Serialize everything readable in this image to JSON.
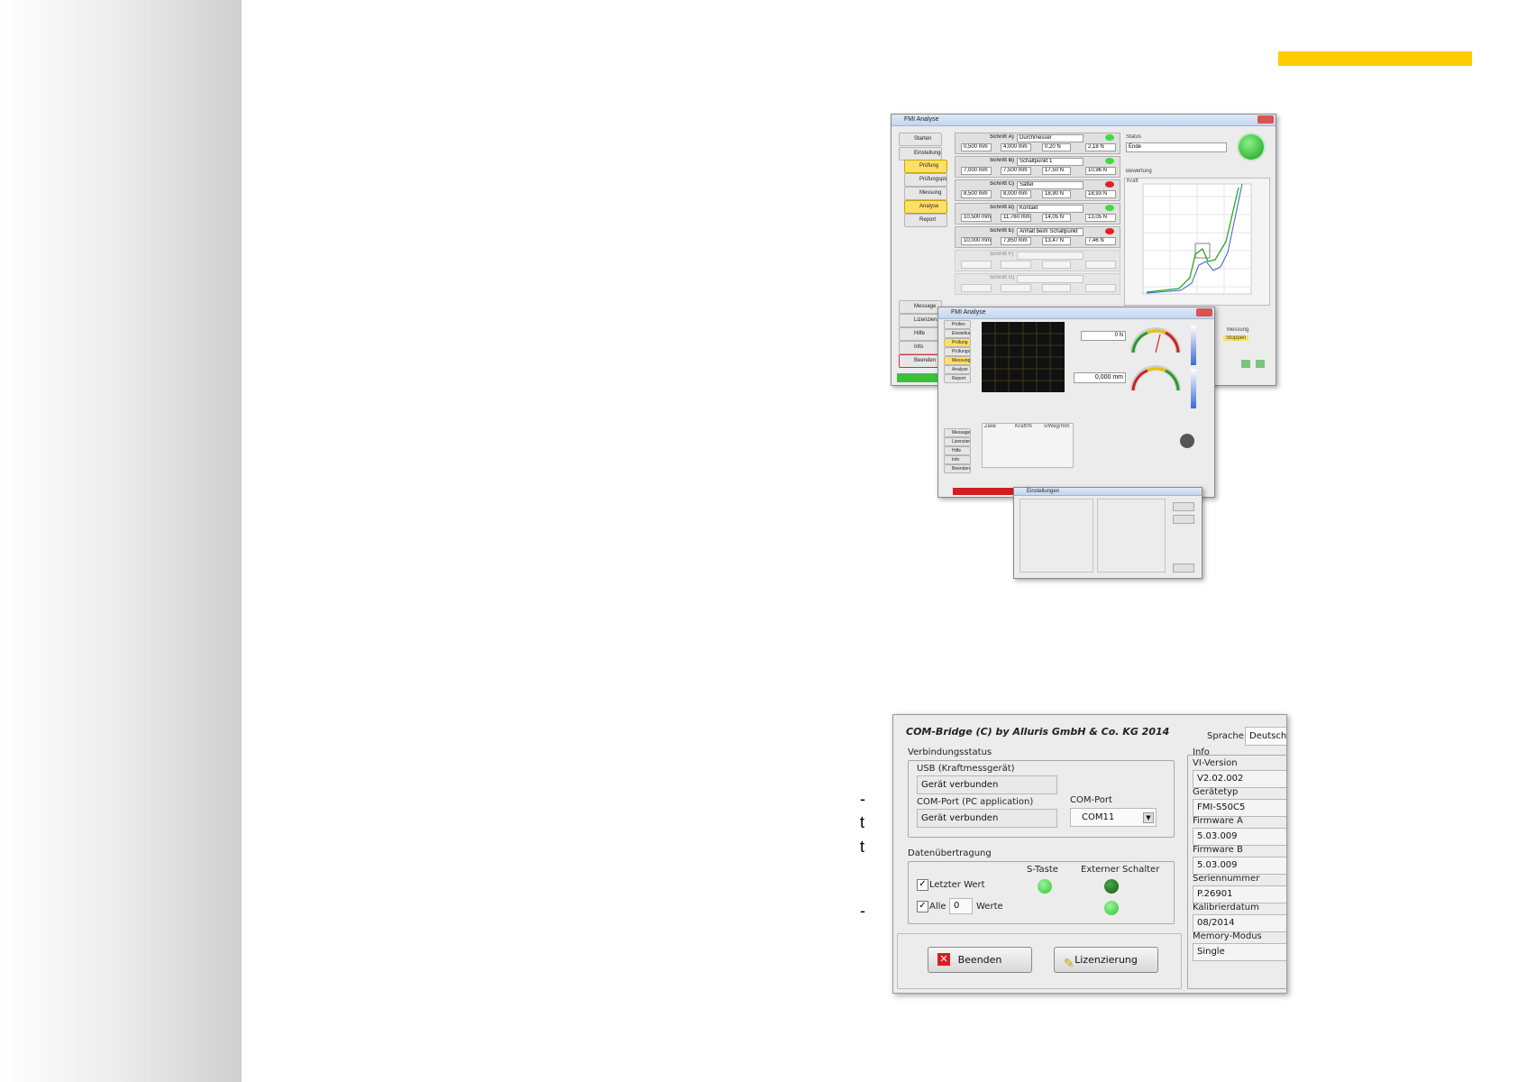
{
  "page": {
    "fragments": [
      "-",
      "t",
      "t",
      "-"
    ]
  },
  "colors": {
    "accent": "#ffcc00",
    "led_green": "#3ddc3d",
    "led_dark_green": "#1c7a1c",
    "led_red": "#e02020",
    "close_red": "#d9534f"
  },
  "fmi_window": {
    "title": "FMI Analyse",
    "nav": [
      "Starten",
      "Einstellungen",
      "Prüfung",
      "Prüfungsplan",
      "Messung",
      "Analyse",
      "Report"
    ],
    "nav_bottom": [
      "Message",
      "Lizenzierung",
      "Hilfe",
      "Info",
      "Beenden"
    ],
    "steps": [
      {
        "label": "Schritt A)",
        "name": "Durchmesser",
        "status": "green",
        "sIn": "0,500 mm",
        "sOut": "4,000 mm",
        "fIn": "0,20 N",
        "fOut": "2,18 N"
      },
      {
        "label": "Schritt B)",
        "name": "Schaltpunkt 1",
        "status": "green",
        "sIn": "7,000 mm",
        "sOut": "7,500 mm",
        "fIn": "17,50 N",
        "fOut": "10,96 N"
      },
      {
        "label": "Schritt C)",
        "name": "Sattel",
        "status": "red",
        "sIn": "8,500 mm",
        "sOut": "8,000 mm",
        "fIn": "18,90 N",
        "fOut": "18,93 N"
      },
      {
        "label": "Schritt D)",
        "name": "Kontakt",
        "status": "green",
        "sIn": "10,500 mm",
        "sOut": "11,760 mm",
        "fIn": "14,05 N",
        "fOut": "13,05 N"
      },
      {
        "label": "Schritt E)",
        "name": "Anhalt beim Schaltpunkt",
        "status": "red",
        "sIn": "10,000 mm",
        "sOut": "7,850 mm",
        "fIn": "13,47 N",
        "fOut": "7,46 N"
      },
      {
        "label": "Schritt F)",
        "name": "",
        "status": "none",
        "sIn": "",
        "sOut": "",
        "fIn": "",
        "fOut": ""
      },
      {
        "label": "Schritt G)",
        "name": "",
        "status": "none",
        "sIn": "",
        "sOut": "",
        "fIn": "",
        "fOut": ""
      }
    ],
    "status_label": "Status",
    "status_value": "Ende",
    "chart_label": "Bewertung",
    "chart_y_label": "Kraft",
    "footer_labels": [
      "Messung",
      "Stoppen"
    ]
  },
  "measure_window": {
    "title": "FMI Analyse",
    "force_value": "0 N",
    "distance_value": "0,000 mm",
    "nav": [
      "Prüfen",
      "Einstellungen",
      "Prüfung",
      "Prüfungsplan",
      "Messung",
      "Analyse",
      "Report"
    ],
    "nav_bottom": [
      "Message",
      "Lizenzierung",
      "Hilfe",
      "Info",
      "Beenden"
    ],
    "table_headers": [
      "Zeile",
      "Kraft/N",
      "s/Weg/mm"
    ]
  },
  "settings_window": {
    "title": "Einstellungen"
  },
  "com_bridge": {
    "title": "COM-Bridge (C) by Alluris GmbH & Co. KG 2014",
    "language_label": "Sprache",
    "language_value": "Deutsch",
    "connection_group": "Verbindungsstatus",
    "usb_label": "USB (Kraftmessgerät)",
    "usb_value": "Gerät verbunden",
    "com_pc_label": "COM-Port (PC application)",
    "com_pc_value": "Gerät verbunden",
    "com_port_label": "COM-Port",
    "com_port_value": "COM11",
    "transfer_group": "Datenübertragung",
    "s_key_label": "S-Taste",
    "ext_switch_label": "Externer Schalter",
    "last_value_label": "Letzter Wert",
    "all_label": "Alle",
    "all_count": "0",
    "values_label": "Werte",
    "exit_button": "Beenden",
    "license_button": "Lizenzierung",
    "info_group": "Info",
    "info": [
      {
        "label": "VI-Version",
        "value": "V2.02.002"
      },
      {
        "label": "Gerätetyp",
        "value": "FMI-S50C5"
      },
      {
        "label": "Firmware A",
        "value": "5.03.009"
      },
      {
        "label": "Firmware B",
        "value": "5.03.009"
      },
      {
        "label": "Seriennummer",
        "value": "P.26901"
      },
      {
        "label": "Kalibrierdatum",
        "value": "08/2014"
      },
      {
        "label": "Memory-Modus",
        "value": "Single"
      }
    ]
  }
}
